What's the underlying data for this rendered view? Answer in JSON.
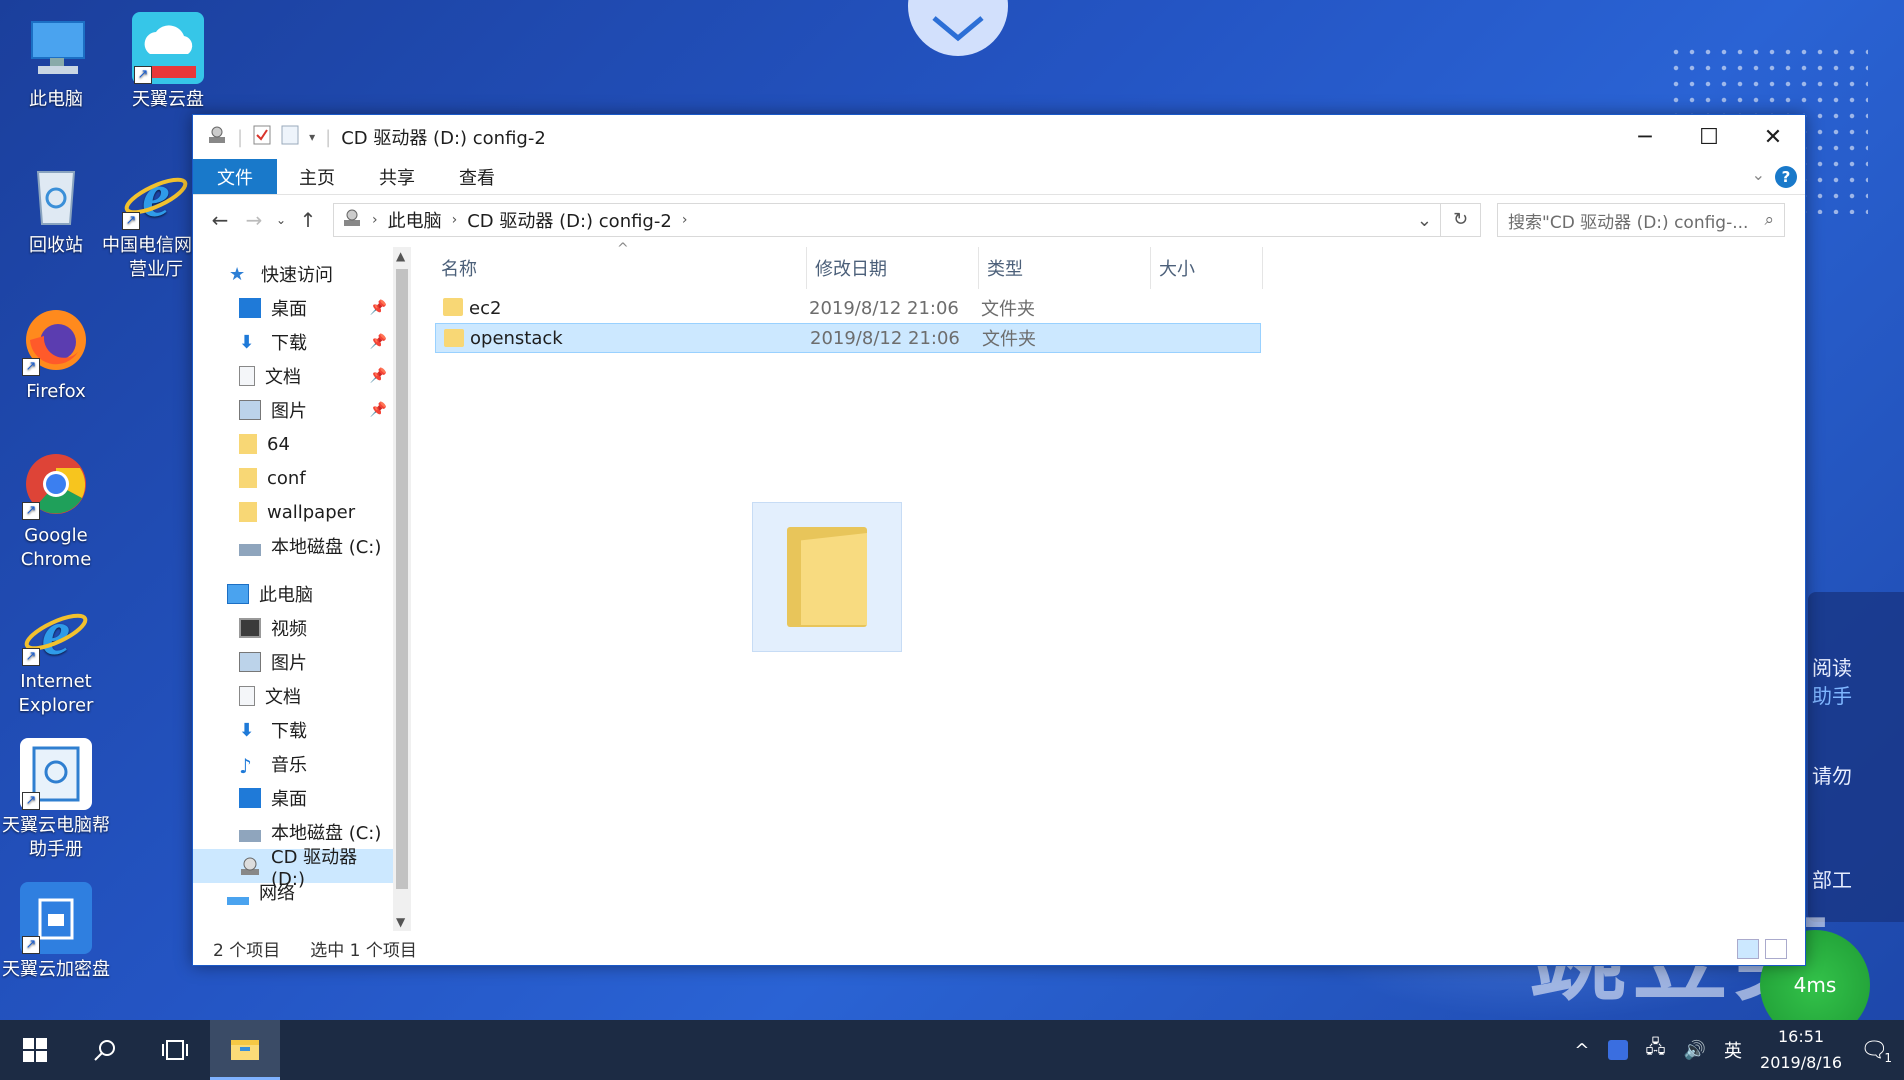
{
  "desktop": {
    "icons": [
      {
        "label": "此电脑"
      },
      {
        "label": "天翼云盘"
      },
      {
        "label": "回收站"
      },
      {
        "label": "中国电信网上营业厅"
      },
      {
        "label": "Firefox"
      },
      {
        "label": "Google Chrome"
      },
      {
        "label": "Internet Explorer"
      },
      {
        "label": "天翼云电脑帮助手册"
      },
      {
        "label": "天翼云加密盘"
      }
    ],
    "side_panel": {
      "line1": "阅读",
      "line2": "助手",
      "line3": "请勿",
      "line4": "部工"
    },
    "watermark": "豌豆荚",
    "badge": "4ms"
  },
  "window": {
    "title": "CD 驱动器 (D:) config-2",
    "ribbon": {
      "file": "文件",
      "home": "主页",
      "share": "共享",
      "view": "查看",
      "help": "?"
    },
    "address": {
      "crumb1": "此电脑",
      "crumb2": "CD 驱动器 (D:) config-2"
    },
    "search_placeholder": "搜索\"CD 驱动器 (D:) config-...",
    "nav": {
      "quick_access": "快速访问",
      "items": [
        {
          "label": "桌面"
        },
        {
          "label": "下载"
        },
        {
          "label": "文档"
        },
        {
          "label": "图片"
        },
        {
          "label": "64"
        },
        {
          "label": "conf"
        },
        {
          "label": "wallpaper"
        },
        {
          "label": "本地磁盘 (C:)"
        }
      ],
      "this_pc": "此电脑",
      "pc_items": [
        {
          "label": "视频"
        },
        {
          "label": "图片"
        },
        {
          "label": "文档"
        },
        {
          "label": "下载"
        },
        {
          "label": "音乐"
        },
        {
          "label": "桌面"
        },
        {
          "label": "本地磁盘 (C:)"
        },
        {
          "label": "CD 驱动器 (D:)"
        }
      ],
      "network": "网络"
    },
    "columns": {
      "name": "名称",
      "modified": "修改日期",
      "type": "类型",
      "size": "大小"
    },
    "files": [
      {
        "name": "ec2",
        "modified": "2019/8/12 21:06",
        "type": "文件夹"
      },
      {
        "name": "openstack",
        "modified": "2019/8/12 21:06",
        "type": "文件夹"
      }
    ],
    "status": {
      "count": "2 个项目",
      "selected": "选中 1 个项目"
    }
  },
  "taskbar": {
    "time": "16:51",
    "date": "2019/8/16",
    "ime": "英",
    "notification_count": "1"
  },
  "colors": {
    "accent": "#1979ca",
    "selection": "#cce8ff",
    "taskbar": "#1c2b44"
  }
}
